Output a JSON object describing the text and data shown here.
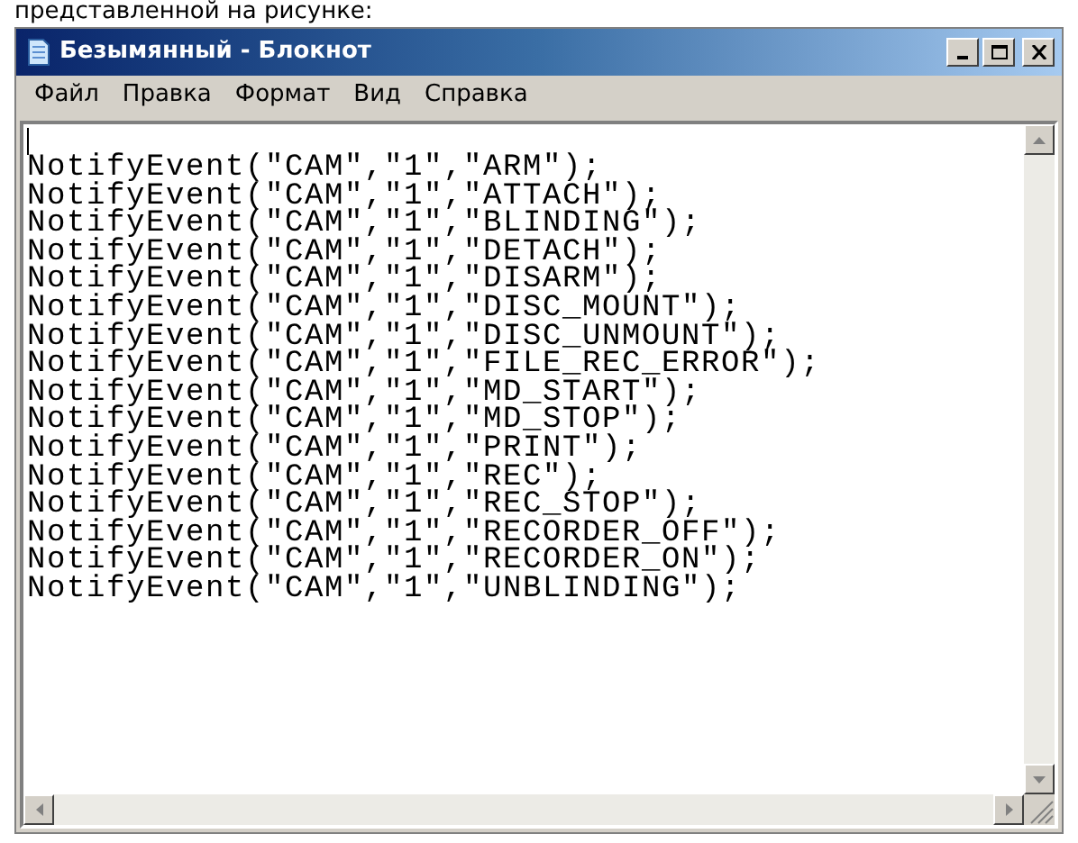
{
  "caption": "представленной на рисунке:",
  "window": {
    "title": "Безымянный - Блокнот"
  },
  "menu": [
    "Файл",
    "Правка",
    "Формат",
    "Вид",
    "Справка"
  ],
  "editor": {
    "lines": [
      "NotifyEvent(\"CAM\",\"1\",\"ARM\");",
      "NotifyEvent(\"CAM\",\"1\",\"ATTACH\");",
      "NotifyEvent(\"CAM\",\"1\",\"BLINDING\");",
      "NotifyEvent(\"CAM\",\"1\",\"DETACH\");",
      "NotifyEvent(\"CAM\",\"1\",\"DISARM\");",
      "NotifyEvent(\"CAM\",\"1\",\"DISC_MOUNT\");",
      "NotifyEvent(\"CAM\",\"1\",\"DISC_UNMOUNT\");",
      "NotifyEvent(\"CAM\",\"1\",\"FILE_REC_ERROR\");",
      "NotifyEvent(\"CAM\",\"1\",\"MD_START\");",
      "NotifyEvent(\"CAM\",\"1\",\"MD_STOP\");",
      "NotifyEvent(\"CAM\",\"1\",\"PRINT\");",
      "NotifyEvent(\"CAM\",\"1\",\"REC\");",
      "NotifyEvent(\"CAM\",\"1\",\"REC_STOP\");",
      "NotifyEvent(\"CAM\",\"1\",\"RECORDER_OFF\");",
      "NotifyEvent(\"CAM\",\"1\",\"RECORDER_ON\");",
      "NotifyEvent(\"CAM\",\"1\",\"UNBLINDING\");"
    ]
  }
}
